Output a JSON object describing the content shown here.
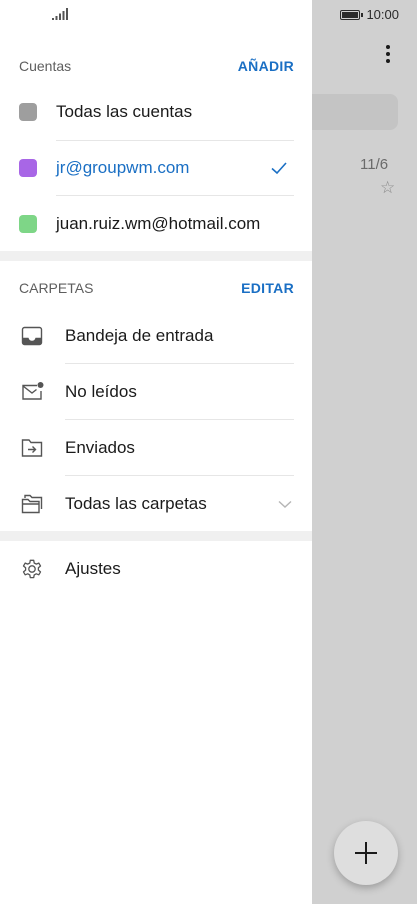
{
  "status_bar": {
    "time": "10:00"
  },
  "background": {
    "date": "11/6"
  },
  "drawer": {
    "accounts": {
      "title": "Cuentas",
      "action": "AÑADIR",
      "items": [
        {
          "label": "Todas las cuentas",
          "color": "#9e9e9e",
          "selected": false
        },
        {
          "label": "jr@groupwm.com",
          "color": "#a866e6",
          "selected": true
        },
        {
          "label": "juan.ruiz.wm@hotmail.com",
          "color": "#7ed687",
          "selected": false
        }
      ]
    },
    "folders": {
      "title": "CARPETAS",
      "action": "EDITAR",
      "items": [
        {
          "label": "Bandeja de entrada",
          "icon": "inbox-icon"
        },
        {
          "label": "No leídos",
          "icon": "unread-mail-icon"
        },
        {
          "label": "Enviados",
          "icon": "sent-folder-icon"
        },
        {
          "label": "Todas las carpetas",
          "icon": "folders-icon"
        }
      ]
    },
    "settings": {
      "label": "Ajustes",
      "icon": "gear-icon"
    }
  },
  "colors": {
    "accent": "#1a6fc4"
  }
}
